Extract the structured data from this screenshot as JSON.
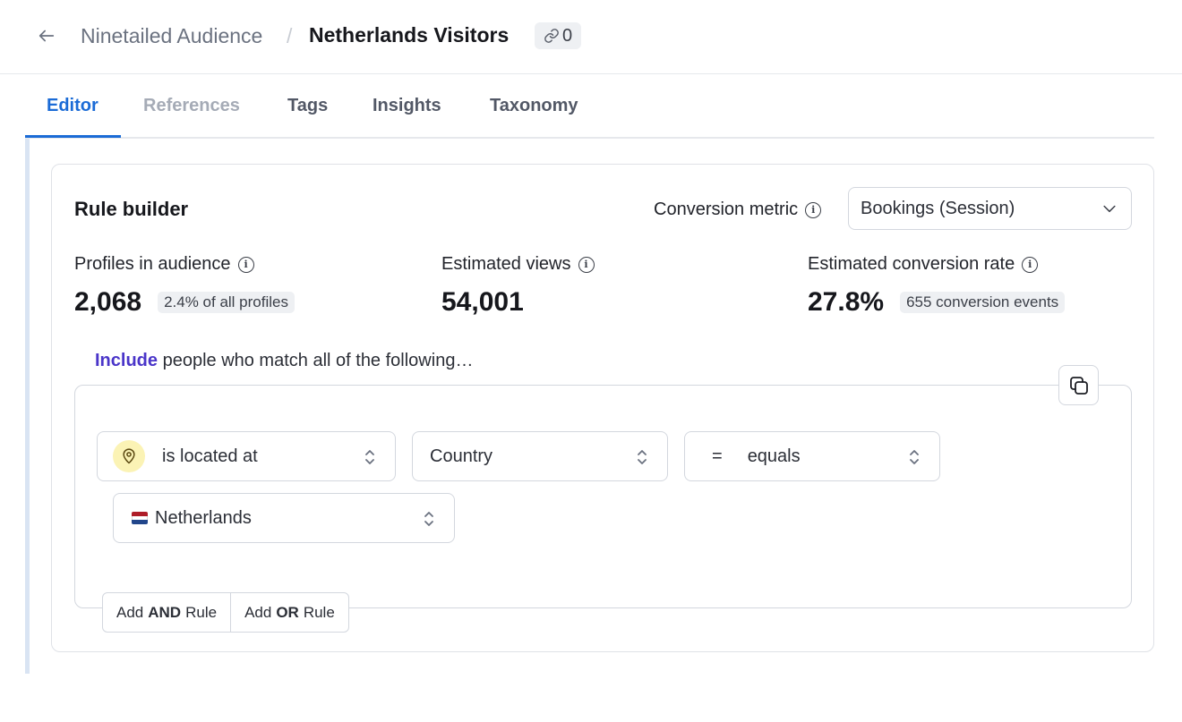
{
  "header": {
    "breadcrumb_parent": "Ninetailed Audience",
    "breadcrumb_separator": "/",
    "title": "Netherlands Visitors",
    "reference_count": "0"
  },
  "tabs": [
    {
      "label": "Editor",
      "state": "active"
    },
    {
      "label": "References",
      "state": "disabled"
    },
    {
      "label": "Tags",
      "state": "normal"
    },
    {
      "label": "Insights",
      "state": "normal"
    },
    {
      "label": "Taxonomy",
      "state": "normal"
    }
  ],
  "rule_builder": {
    "title": "Rule builder",
    "conversion_metric_label": "Conversion metric",
    "conversion_metric_value": "Bookings (Session)",
    "stats": [
      {
        "label": "Profiles in audience",
        "value": "2,068",
        "badge": "2.4% of all profiles"
      },
      {
        "label": "Estimated views",
        "value": "54,001",
        "badge": ""
      },
      {
        "label": "Estimated conversion rate",
        "value": "27.8%",
        "badge": "655 conversion events"
      }
    ],
    "include_keyword": "Include",
    "include_rest": " people who match all of the following…",
    "rule": {
      "condition": "is located at",
      "attribute": "Country",
      "operator_symbol": "=",
      "operator": "equals",
      "value": "Netherlands"
    },
    "add_and": {
      "prefix": "Add",
      "keyword": "AND",
      "suffix": "Rule"
    },
    "add_or": {
      "prefix": "Add",
      "keyword": "OR",
      "suffix": "Rule"
    }
  },
  "colors": {
    "accent_blue": "#1b6bd6",
    "include_purple": "#4a35c9",
    "pin_bg": "#fbf3b5",
    "flag_red": "#ae1c28",
    "flag_white": "#ffffff",
    "flag_blue": "#21468b"
  },
  "icons": {
    "back": "arrow-left-icon",
    "link": "link-icon",
    "info": "info-icon",
    "chevron": "chevron-down-icon",
    "copy": "copy-icon",
    "location": "map-pin-icon",
    "sort": "chevron-up-down-icon",
    "flag": "netherlands-flag-icon"
  }
}
